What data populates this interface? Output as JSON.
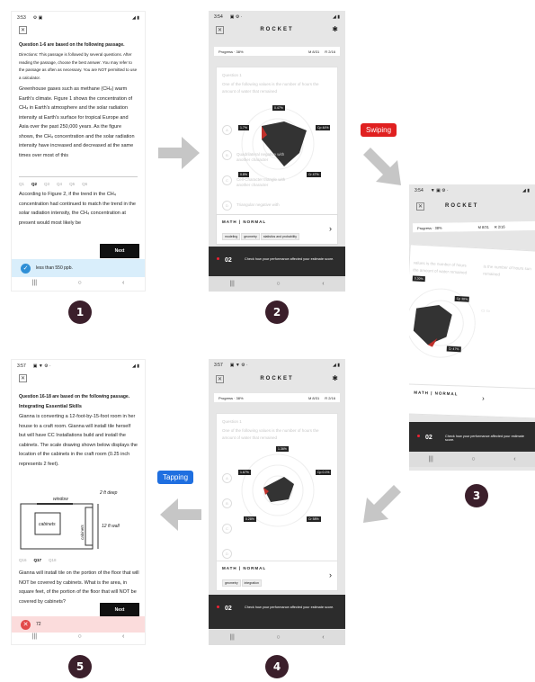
{
  "screens": {
    "s1": {
      "time": "3:53",
      "passage_heading": "Question 1-6 are based on the following passage.",
      "directions": "Directions: This passage is followed by several questions. After reading the passage, choose the best answer. You may refer to the passage as often as necessary. You are NOT permitted to use a calculator.",
      "passage": "Greenhouse gases such as methane (CH₄) warm Earth's climate. Figure 1 shows the concentration of CH₄ in Earth's atmosphere and the solar radiation intensity at Earth's surface for tropical Europe and Asia over the past 250,000 years. As the figure shows, the CH₄ concentration and the solar radiation intensity have increased and decreased at the same times over most of this",
      "q_tabs": [
        "Q1",
        "Q2",
        "Q3",
        "Q4",
        "Q5",
        "Q6"
      ],
      "question": "According to Figure 2, if the trend in the CH₄ concentration had continued to match the trend in the solar radiation intensity, the CH₄ concentration at present would most likely be",
      "next": "Next",
      "answer": "less than 550 ppb."
    },
    "s2": {
      "time": "3:54",
      "title": "ROCKET",
      "progress": "Progress · 38%",
      "m_stat": "M 8/31",
      "r_stat": "R 2/16",
      "question_label": "Question 1",
      "question_text": "One of the following values is the number of hours the amount of water that remained",
      "chart_labels": [
        "0.47%",
        "1.7%",
        "Cp 44%",
        "Cr 47%",
        "0.8%"
      ],
      "option_texts": [
        "",
        "Quadrilateral negative with another character",
        "Cell-Character triangle with another character",
        "Triangular negative with"
      ],
      "option_letters": [
        "A",
        "B",
        "C",
        "D"
      ],
      "subject": "MATH | NORMAL",
      "tags": [
        "modeling",
        "geometry",
        "statistics and probability"
      ],
      "footer_num": "02",
      "footer_text": "Check how your performance affected your estimate score."
    },
    "s3": {
      "time": "3:54",
      "title": "ROCKET",
      "progress": "Progress · 38%",
      "m_stat": "M 8/31",
      "r_stat": "R 2/16",
      "chart_labels": [
        "0.30%",
        "0.20%",
        "Cp 38%",
        "Cr 47%"
      ],
      "left_text": "values is the number of hours the amount of water remained",
      "right_text": "is the number of hours sun remained",
      "subject": "MATH | NORMAL",
      "footer_num": "02",
      "footer_text": "Check how your performance affected your estimate score."
    },
    "s4": {
      "time": "3:57",
      "title": "ROCKET",
      "progress": "Progress · 38%",
      "m_stat": "M 8/31",
      "r_stat": "R 2/16",
      "question_label": "Question 1",
      "question_text": "One of the following values is the number of hours the amount of water that remained",
      "chart_labels": [
        "1.36%",
        "1.67%",
        "Cp 0.1%",
        "0.28%",
        "Cr 58%"
      ],
      "option_letters": [
        "A",
        "B",
        "C",
        "D"
      ],
      "subject": "MATH | NORMAL",
      "tags": [
        "geometry",
        "integration"
      ],
      "footer_num": "02",
      "footer_text": "Check how your performance affected your estimate score."
    },
    "s5": {
      "time": "3:57",
      "passage_heading": "Question 16-18 are based on the following passage.",
      "section": "Integrating Essential Skills",
      "passage": "Gianna is converting a 12-foot-by-15-foot room in her house to a craft room. Gianna will install tile herself but will have CC Installations build and install the cabinets. The scale drawing shown below displays the location of the cabinets in the craft room (0.25 inch represents 2 feet).",
      "fig_window": "window",
      "fig_deep": "2 ft deep",
      "fig_cab1": "cabinets",
      "fig_cab2": "cabinets",
      "fig_wall": "12 ft wall",
      "q_tabs": [
        "Q16",
        "Q17",
        "Q18"
      ],
      "question": "Gianna will install tile on the portion of the floor that will NOT be covered by cabinets. What is the area, in square feet, of the portion of the floor that will NOT be covered by cabinets?",
      "next": "Next",
      "answer": "72"
    }
  },
  "labels": {
    "swiping": "Swiping",
    "tapping": "Tapping"
  },
  "steps": [
    "1",
    "2",
    "3",
    "4",
    "5"
  ],
  "colors": {
    "swipe_tag": "#e02020",
    "tap_tag": "#1f6fe0",
    "step_circle": "#3b1f2b",
    "correct": "#d9eefb",
    "wrong": "#fbdcdc",
    "arrow": "#c6c6c6"
  }
}
